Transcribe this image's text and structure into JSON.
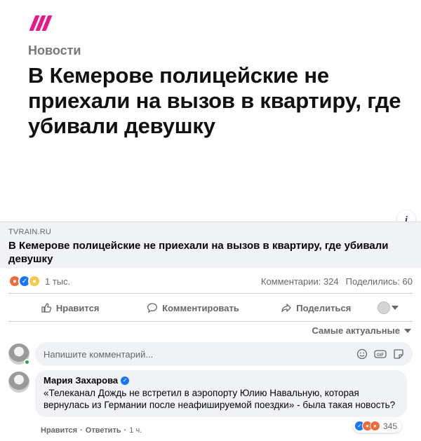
{
  "preview": {
    "kicker": "Новости",
    "headline": "В Кемерове полицейские не приехали на вызов в квартиру, где убивали девушку"
  },
  "link": {
    "domain": "TVRAIN.RU",
    "title": "В Кемерове полицейские не приехали на вызов в квартиру, где убивали девушку",
    "info_icon": "info-icon"
  },
  "stats": {
    "reactions": [
      "angry",
      "like",
      "sad"
    ],
    "reaction_count": "1 тыс.",
    "comments": "Комментарии: 324",
    "shares": "Поделились: 60"
  },
  "actions": {
    "like": "Нравится",
    "comment": "Комментировать",
    "share": "Поделиться"
  },
  "sort": {
    "label": "Самые актуальные"
  },
  "composer": {
    "placeholder": "Напишите комментарий...",
    "tools": [
      "emoji-icon",
      "gif-icon",
      "sticker-icon"
    ]
  },
  "comment": {
    "author": "Мария Захарова",
    "text": "«Телеканал Дождь не встретил в аэропорту Юлию Навальную, которая вернулась из Германии после неафишируемой поездки» - была такая новость?",
    "reactions": [
      "like",
      "angry",
      "angry"
    ],
    "reaction_count": "345",
    "like_label": "Нравится",
    "separator": "·",
    "reply_label": "Ответить",
    "time": "1 ч."
  },
  "colors": {
    "brand": "#e8178a",
    "facebook_blue": "#1877f2",
    "muted": "#65676b"
  }
}
